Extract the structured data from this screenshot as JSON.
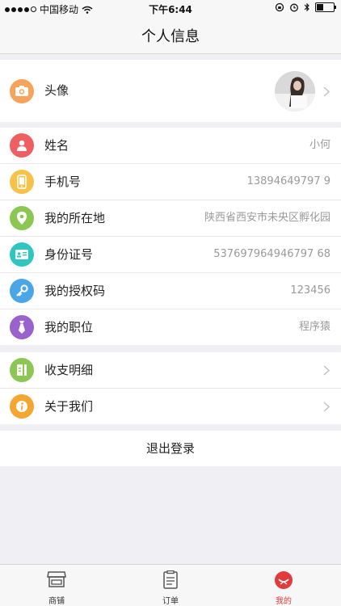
{
  "status_bar": {
    "carrier": "中国移动",
    "time": "下午6:44"
  },
  "nav": {
    "title": "个人信息"
  },
  "avatar_row": {
    "label": "头像"
  },
  "info_rows": [
    {
      "label": "姓名",
      "value": "小何",
      "icon": "user-icon",
      "color": "#ef5e60"
    },
    {
      "label": "手机号",
      "value": "13894649797 9",
      "icon": "phone-icon",
      "color": "#f6c24a"
    },
    {
      "label": "我的所在地",
      "value": "陕西省西安市未央区孵化园",
      "icon": "location-icon",
      "color": "#8cc653"
    },
    {
      "label": "身份证号",
      "value": "537697964946797 68",
      "icon": "id-card-icon",
      "color": "#2ec6c0"
    },
    {
      "label": "我的授权码",
      "value": "123456",
      "icon": "key-icon",
      "color": "#4aa6e8"
    },
    {
      "label": "我的职位",
      "value": "程序猿",
      "icon": "tie-icon",
      "color": "#9a62cc"
    }
  ],
  "link_rows": [
    {
      "label": "收支明细",
      "icon": "ledger-icon",
      "color": "#8cc653"
    },
    {
      "label": "关于我们",
      "icon": "info-icon",
      "color": "#f3a630"
    }
  ],
  "logout": {
    "label": "退出登录"
  },
  "tabbar": {
    "items": [
      {
        "label": "商铺",
        "icon": "shop-icon"
      },
      {
        "label": "订单",
        "icon": "order-icon"
      },
      {
        "label": "我的",
        "icon": "profile-icon"
      }
    ],
    "active_color": "#e13b3b"
  },
  "camera_icon_color": "#f7a35c"
}
